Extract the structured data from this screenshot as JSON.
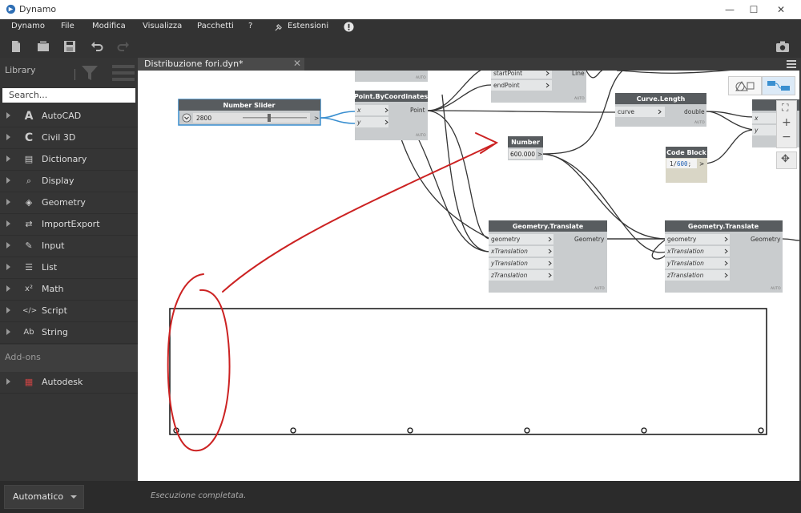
{
  "window": {
    "title": "Dynamo",
    "buttons": {
      "minimize": "—",
      "maximize": "☐",
      "close": "✕"
    }
  },
  "menu": [
    {
      "label": "Dynamo"
    },
    {
      "label": "File"
    },
    {
      "label": "Modifica"
    },
    {
      "label": "Visualizza"
    },
    {
      "label": "Pacchetti"
    },
    {
      "label": "?"
    },
    {
      "label": "Estensioni"
    }
  ],
  "library": {
    "title": "Library",
    "search_placeholder": "Search...",
    "categories": [
      {
        "label": "AutoCAD",
        "icon": "A"
      },
      {
        "label": "Civil 3D",
        "icon": "C"
      },
      {
        "label": "Dictionary",
        "icon": "▤"
      },
      {
        "label": "Display",
        "icon": "⌕"
      },
      {
        "label": "Geometry",
        "icon": "◈"
      },
      {
        "label": "ImportExport",
        "icon": "⇄"
      },
      {
        "label": "Input",
        "icon": "✎"
      },
      {
        "label": "List",
        "icon": "☰"
      },
      {
        "label": "Math",
        "icon": "x²"
      },
      {
        "label": "Script",
        "icon": "</>"
      },
      {
        "label": "String",
        "icon": "Ab"
      }
    ],
    "addons_title": "Add-ons",
    "addons": [
      {
        "label": "Autodesk",
        "icon": "▦"
      }
    ]
  },
  "tab": {
    "label": "Distribuzione fori.dyn*",
    "close": "✕"
  },
  "nodes": {
    "number_slider": {
      "title": "Number Slider",
      "value": "2800",
      "out": ">"
    },
    "point_by_coords": {
      "title": "Point.ByCoordinates",
      "inputs": [
        "x",
        "y"
      ],
      "output": "Point",
      "lacing": "AUTO"
    },
    "line_node": {
      "inputs": [
        "startPoint",
        "endPoint"
      ],
      "output": "Line",
      "lacing": "AUTO"
    },
    "curve_length": {
      "title": "Curve.Length",
      "input": "curve",
      "output": "double",
      "lacing": "AUTO"
    },
    "number": {
      "title": "Number",
      "value": "600.000",
      "out": ">"
    },
    "code_block": {
      "title": "Code Block",
      "code_prefix": "1/",
      "code_value": "600",
      "code_suffix": ";",
      "out": ">"
    },
    "translate1": {
      "title": "Geometry.Translate",
      "inputs": [
        "geometry",
        "xTranslation",
        "yTranslation",
        "zTranslation"
      ],
      "output": "Geometry",
      "lacing": "AUTO"
    },
    "translate2": {
      "title": "Geometry.Translate",
      "inputs": [
        "geometry",
        "xTranslation",
        "yTranslation",
        "zTranslation"
      ],
      "output": "Geometry",
      "lacing": "AUTO"
    },
    "right_node": {
      "inputs": [
        "x",
        "y"
      ]
    }
  },
  "zoom_controls": {
    "fit": "⛶",
    "zoom_in": "+",
    "zoom_out": "−",
    "pan": "✥"
  },
  "status": {
    "run_mode": "Automatico",
    "message": "Esecuzione completata."
  },
  "colors": {
    "node_header": "#585c5f",
    "node_body": "#c9ccce",
    "annotation": "#cc2222",
    "wire": "#333333",
    "wire_active": "#3a8fd0"
  }
}
